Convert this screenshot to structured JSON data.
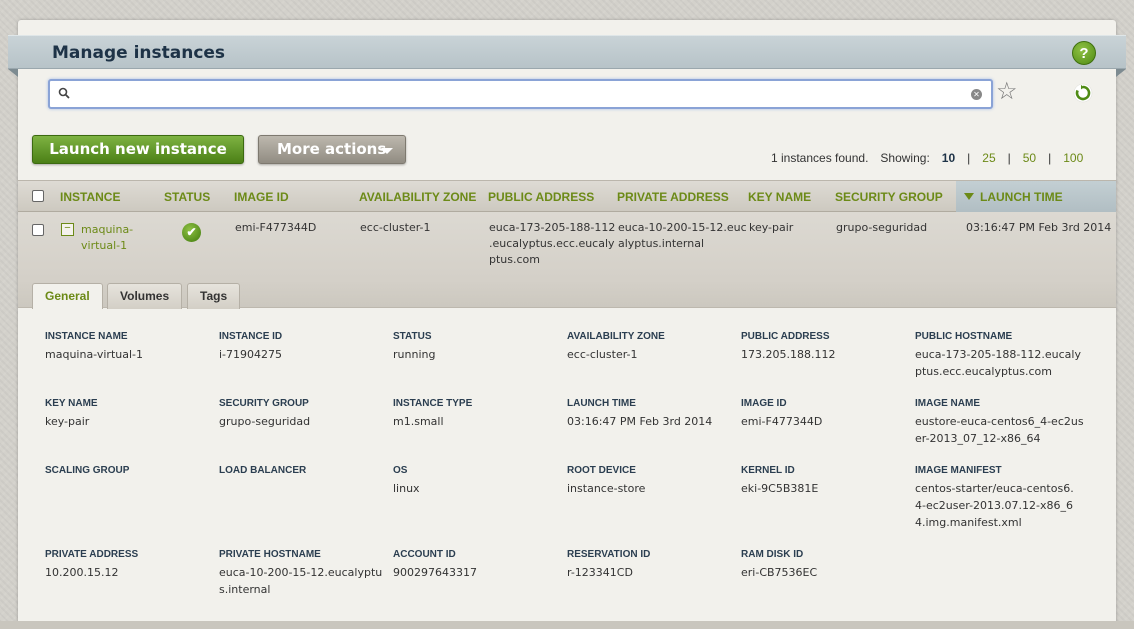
{
  "page": {
    "title": "Manage instances",
    "help_glyph": "?"
  },
  "search": {
    "value": "",
    "placeholder": ""
  },
  "toolbar": {
    "launch_label": "Launch new instance",
    "more_actions_label": "More actions",
    "found_text": "1 instances found.",
    "showing_label": "Showing:",
    "page_sizes": [
      "10",
      "25",
      "50",
      "100"
    ],
    "current_page_size": "10"
  },
  "table": {
    "headers": {
      "instance": "INSTANCE",
      "status": "STATUS",
      "image_id": "IMAGE ID",
      "zone": "AVAILABILITY ZONE",
      "public_address": "PUBLIC ADDRESS",
      "private_address": "PRIVATE ADDRESS",
      "key_name": "KEY NAME",
      "security_group": "SECURITY GROUP",
      "launch_time": "LAUNCH TIME"
    },
    "sort_column": "launch_time",
    "rows": [
      {
        "instance_line1": "maquina-",
        "instance_line2": "virtual-1",
        "status_glyph": "✔",
        "status": "running",
        "image_id": "emi-F477344D",
        "zone": "ecc-cluster-1",
        "public_address_1": "euca-173-205-188-112",
        "public_address_2": ".eucalyptus.ecc.eucaly",
        "public_address_3": "ptus.com",
        "private_address_1": "euca-10-200-15-12.euc",
        "private_address_2": "alyptus.internal",
        "key_name": "key-pair",
        "security_group": "grupo-seguridad",
        "launch_time": "03:16:47 PM Feb 3rd 2014"
      }
    ]
  },
  "tabs": [
    {
      "label": "General",
      "active": true
    },
    {
      "label": "Volumes",
      "active": false
    },
    {
      "label": "Tags",
      "active": false
    }
  ],
  "details": {
    "instance_name": {
      "label": "INSTANCE NAME",
      "value": "maquina-virtual-1"
    },
    "instance_id": {
      "label": "INSTANCE ID",
      "value": "i-71904275"
    },
    "status": {
      "label": "STATUS",
      "value": "running"
    },
    "availability_zone": {
      "label": "AVAILABILITY ZONE",
      "value": "ecc-cluster-1"
    },
    "public_address": {
      "label": "PUBLIC ADDRESS",
      "value": "173.205.188.112"
    },
    "public_hostname": {
      "label": "PUBLIC HOSTNAME",
      "value": "euca-173-205-188-112.eucalyptus.ecc.eucalyptus.com"
    },
    "key_name": {
      "label": "KEY NAME",
      "value": "key-pair"
    },
    "security_group": {
      "label": "SECURITY GROUP",
      "value": "grupo-seguridad"
    },
    "instance_type": {
      "label": "INSTANCE TYPE",
      "value": "m1.small"
    },
    "launch_time": {
      "label": "LAUNCH TIME",
      "value": "03:16:47 PM Feb 3rd 2014"
    },
    "image_id": {
      "label": "IMAGE ID",
      "value": "emi-F477344D"
    },
    "image_name": {
      "label": "IMAGE NAME",
      "value": "eustore-euca-centos6_4-ec2user-2013_07_12-x86_64"
    },
    "scaling_group": {
      "label": "SCALING GROUP",
      "value": ""
    },
    "load_balancer": {
      "label": "LOAD BALANCER",
      "value": ""
    },
    "os": {
      "label": "OS",
      "value": "linux"
    },
    "root_device": {
      "label": "ROOT DEVICE",
      "value": "instance-store"
    },
    "kernel_id": {
      "label": "KERNEL ID",
      "value": "eki-9C5B381E"
    },
    "image_manifest": {
      "label": "IMAGE MANIFEST",
      "value": "centos-starter/euca-centos6.4-ec2user-2013.07.12-x86_64.img.manifest.xml"
    },
    "private_address": {
      "label": "PRIVATE ADDRESS",
      "value": "10.200.15.12"
    },
    "private_hostname": {
      "label": "PRIVATE HOSTNAME",
      "value": "euca-10-200-15-12.eucalyptus.internal"
    },
    "account_id": {
      "label": "ACCOUNT ID",
      "value": "900297643317"
    },
    "reservation_id": {
      "label": "RESERVATION ID",
      "value": "r-123341CD"
    },
    "ramdisk_id": {
      "label": "RAM DISK ID",
      "value": "eri-CB7536EC"
    }
  },
  "colors": {
    "accent": "#6c8a17",
    "launch_button": "#5f961f",
    "title_text": "#1e3347"
  }
}
